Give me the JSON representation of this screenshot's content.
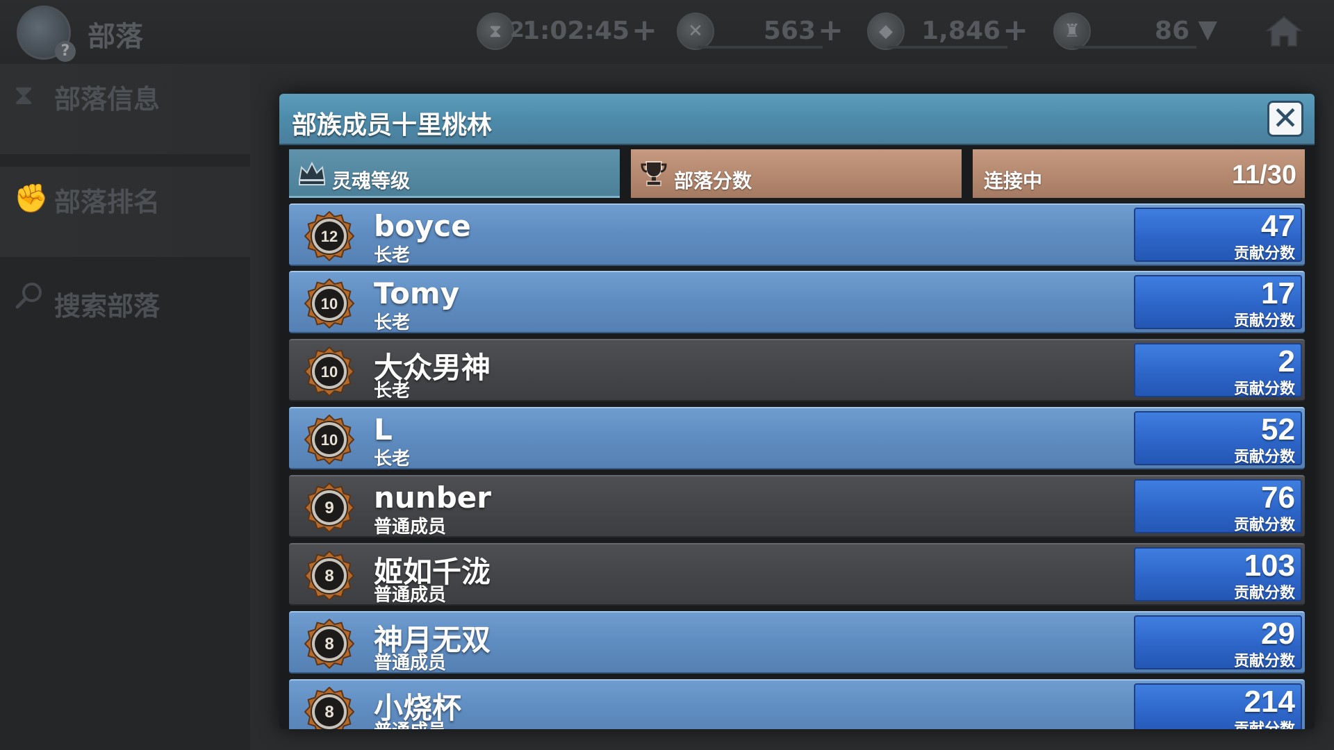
{
  "topbar": {
    "title": "部落",
    "resources": [
      {
        "icon": "hourglass-icon",
        "badge": "2",
        "value": "1:02:45"
      },
      {
        "icon": "coin-icon",
        "value": "563"
      },
      {
        "icon": "gem-icon",
        "value": "1,846"
      },
      {
        "icon": "trophy-icon",
        "value": "86"
      }
    ]
  },
  "sidebar": {
    "items": [
      {
        "label": "部落信息",
        "icon": "hourglass-icon"
      },
      {
        "label": "部落排名",
        "icon": "fist-icon"
      },
      {
        "label": "搜索部落",
        "icon": "search-icon"
      }
    ]
  },
  "dialog": {
    "title": "部族成员十里桃林",
    "tabs": {
      "soul_level": "灵魂等级",
      "tribe_score": "部落分数",
      "connecting": "连接中",
      "member_count": "11/30"
    },
    "score_label": "贡献分数",
    "members": [
      {
        "level": "12",
        "name": "boyce",
        "role": "长老",
        "score": "47",
        "style": "blue"
      },
      {
        "level": "10",
        "name": "Tomy",
        "role": "长老",
        "score": "17",
        "style": "blue"
      },
      {
        "level": "10",
        "name": "大众男神",
        "role": "长老",
        "score": "2",
        "style": "gray"
      },
      {
        "level": "10",
        "name": "L",
        "role": "长老",
        "score": "52",
        "style": "blue"
      },
      {
        "level": "9",
        "name": "nunber",
        "role": "普通成员",
        "score": "76",
        "style": "gray"
      },
      {
        "level": "8",
        "name": "姬如千泷",
        "role": "普通成员",
        "score": "103",
        "style": "gray"
      },
      {
        "level": "8",
        "name": "神月无双",
        "role": "普通成员",
        "score": "29",
        "style": "blue"
      },
      {
        "level": "8",
        "name": "小烧杯",
        "role": "普通成员",
        "score": "214",
        "style": "blue"
      }
    ]
  },
  "colors": {
    "header_blue": "#4d8bab",
    "row_blue": "#5f8cc0",
    "row_gray": "#434548",
    "score_blue": "#2c64c6",
    "tab_tan": "#b58a70"
  }
}
